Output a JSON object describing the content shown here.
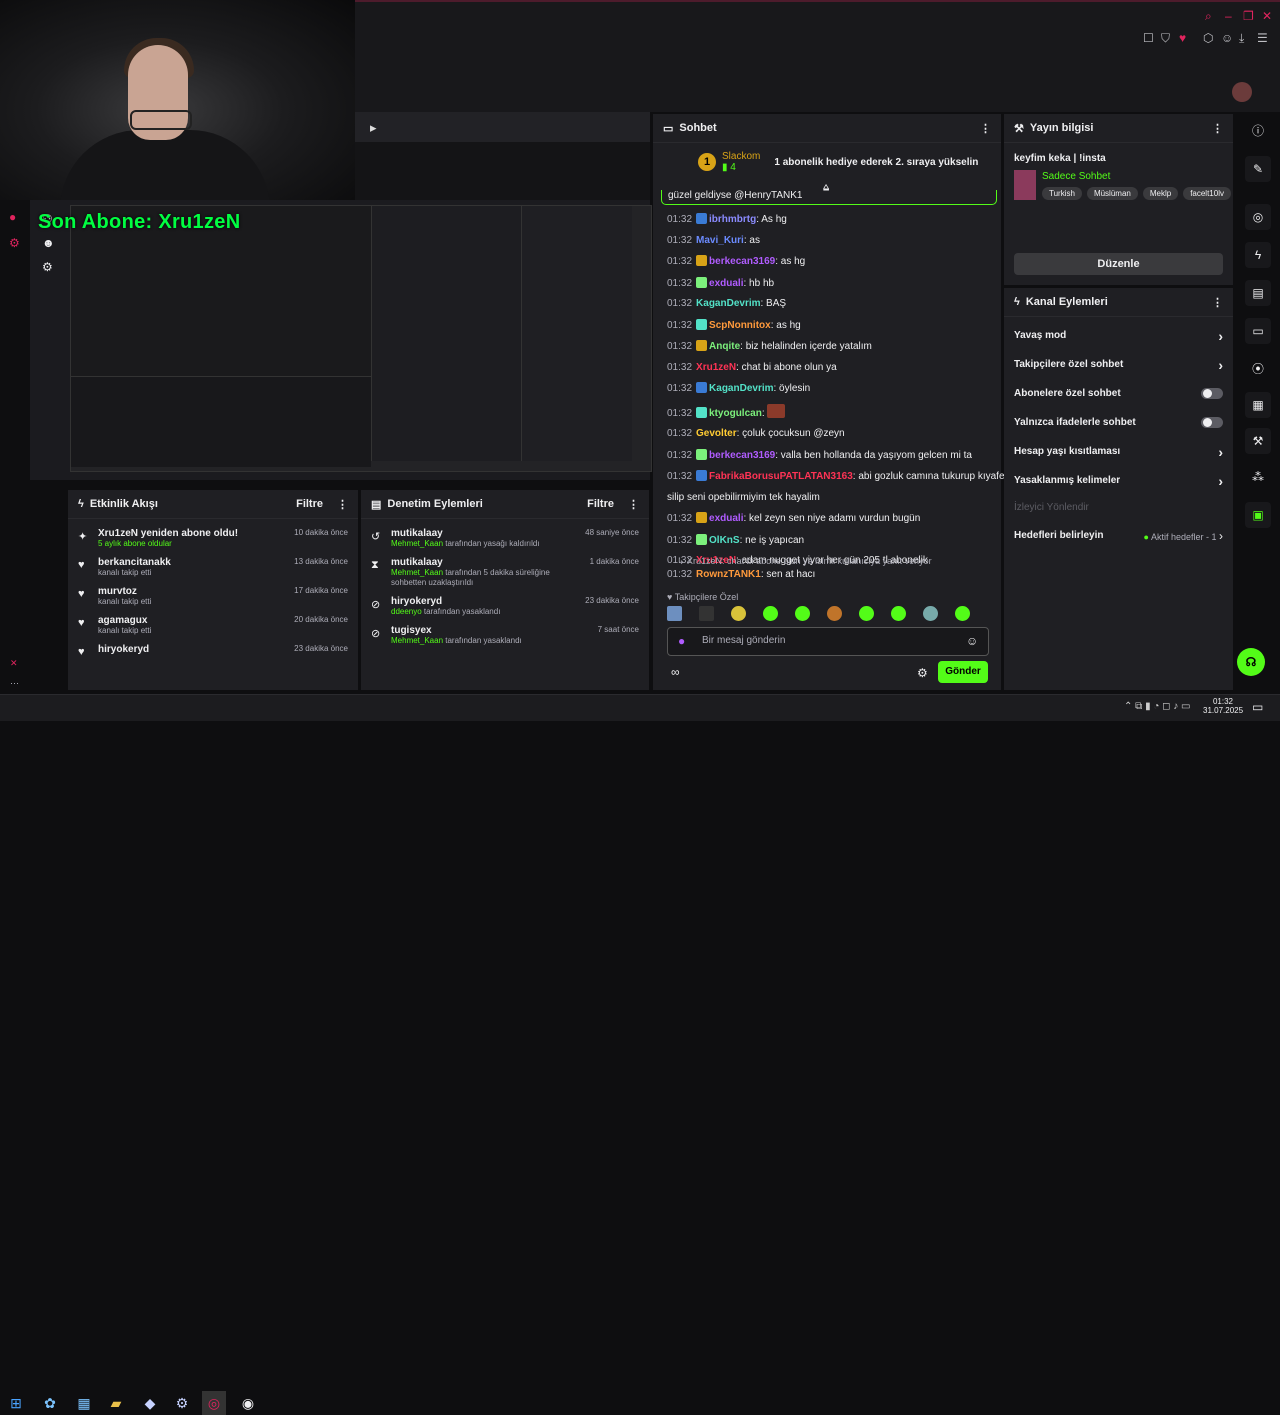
{
  "overlay": {
    "sub_alert": "Son Abone: Xru1zeN"
  },
  "chat": {
    "title": "Sohbet",
    "pinned": {
      "user": "Slackom",
      "count": "4",
      "text": "1 abonelik hediye ederek 2. sıraya yükselin"
    },
    "banner_partial": "güzel geldiyse @HenryTANK1",
    "messages": [
      {
        "time": "01:32",
        "user": "ibrhmbrtg",
        "color": "#8b8bff",
        "text": ": As hg"
      },
      {
        "time": "01:32",
        "user": "Mavi_Kuri",
        "color": "#6b8bff",
        "text": ": as"
      },
      {
        "time": "01:32",
        "user": "berkecan3169",
        "color": "#b05cff",
        "text": ": as hg"
      },
      {
        "time": "01:32",
        "user": "exduali",
        "color": "#b05cff",
        "text": ": hb hb"
      },
      {
        "time": "01:32",
        "user": "KaganDevrim",
        "color": "#53e2c8",
        "text": ": BAŞ"
      },
      {
        "time": "01:32",
        "user": "ScpNonnitox",
        "color": "#ff9a3c",
        "text": ": as hg"
      },
      {
        "time": "01:32",
        "user": "Anqite",
        "color": "#7cf07c",
        "text": ": biz helalinden içerde yatalım"
      },
      {
        "time": "01:32",
        "user": "Xru1zeN",
        "color": "#ff3355",
        "text": ": chat bi abone olun ya"
      },
      {
        "time": "01:32",
        "user": "KaganDevrim",
        "color": "#53e2c8",
        "text": ": öylesin"
      },
      {
        "time": "01:32",
        "user": "ktyogulcan",
        "color": "#7cf07c",
        "text": ":"
      },
      {
        "time": "01:32",
        "user": "Gevolter",
        "color": "#ffcc33",
        "text": ": çoluk çocuksun @zeyn"
      },
      {
        "time": "01:32",
        "user": "berkecan3169",
        "color": "#b05cff",
        "text": ": valla ben hollanda da yaşıyom gelcen mi ta"
      },
      {
        "time": "01:32",
        "user": "FabrikaBorusuPATLATAN3163",
        "color": "#ff3355",
        "text": ": abi gozluk camına tukurup kıyafetimle"
      },
      {
        "time": "",
        "user": "",
        "color": "#efeff1",
        "text": "silip seni opebilirmiyim tek hayalim"
      },
      {
        "time": "01:32",
        "user": "exduali",
        "color": "#b05cff",
        "text": ": kel zeyn sen niye adamı vurdun bugün"
      },
      {
        "time": "01:32",
        "user": "OlKnS",
        "color": "#53e2c8",
        "text": ": ne iş yapıcan"
      },
      {
        "time": "01:32",
        "user": "Xru1zeN",
        "color": "#ff3355",
        "text": ": adam nugget yiyor her gün 205 tl abonelik"
      }
    ],
    "reply_hint": "↳ Xru1zeN: chat bi abone olun ya isimli kullanıcıya yanıt veriyor",
    "last_message": {
      "time": "01:32",
      "user": "RownzTANK1",
      "color": "#ff9a3c",
      "text": ": sen at hacı"
    },
    "emote_header": "Takipçilere Özel",
    "input_placeholder": "Bir mesaj gönderin",
    "send_label": "Gönder"
  },
  "stream_info": {
    "title": "Yayın bilgisi",
    "stream_title": "keyfim keka | !insta",
    "mode": "Sadece Sohbet",
    "tags": [
      "Turkish",
      "Müslüman",
      "Meklp",
      "facelt10lv"
    ],
    "edit_label": "Düzenle"
  },
  "channel_actions": {
    "title": "Kanal Eylemleri",
    "items": [
      {
        "label": "Yavaş mod",
        "kind": "arrow"
      },
      {
        "label": "Takipçilere özel sohbet",
        "kind": "arrow"
      },
      {
        "label": "Abonelere özel sohbet",
        "kind": "toggle"
      },
      {
        "label": "Yalnızca ifadelerle sohbet",
        "kind": "toggle"
      },
      {
        "label": "Hesap yaşı kısıtlaması",
        "kind": "arrow"
      },
      {
        "label": "Yasaklanmış kelimeler",
        "kind": "arrow"
      }
    ],
    "viewer_guide": "İzleyici Yönlendir",
    "goals_label": "Hedefleri belirleyin",
    "goals_status": "Aktif hedefler - 1"
  },
  "activity": {
    "title": "Etkinlik Akışı",
    "filter": "Filtre",
    "items": [
      {
        "name": "Xru1zeN yeniden abone oldu!",
        "sub": "5 aylık abone oldular",
        "time": "10 dakika önce",
        "icon": "✦"
      },
      {
        "name": "berkancitanakk",
        "sub": "kanalı takip etti",
        "time": "13 dakika önce",
        "icon": "♥"
      },
      {
        "name": "murvtoz",
        "sub": "kanalı takip etti",
        "time": "17 dakika önce",
        "icon": "♥"
      },
      {
        "name": "agamagux",
        "sub": "kanalı takip etti",
        "time": "20 dakika önce",
        "icon": "♥"
      },
      {
        "name": "hiryokeryd",
        "sub": "",
        "time": "23 dakika önce",
        "icon": "♥"
      }
    ]
  },
  "moderation": {
    "title": "Denetim Eylemleri",
    "filter": "Filtre",
    "items": [
      {
        "name": "mutikalaay",
        "by": "Mehmet_Kaan",
        "rest": " tarafından yasağı kaldırıldı",
        "time": "48 saniye önce",
        "icon": "↺"
      },
      {
        "name": "mutikalaay",
        "by": "Mehmet_Kaan",
        "rest": " tarafından 5 dakika süreliğine sohbetten uzaklaştırıldı",
        "time": "1 dakika önce",
        "icon": "⧗"
      },
      {
        "name": "hiryokeryd",
        "by": "ddeenyo",
        "rest": " tarafından yasaklandı",
        "time": "23 dakika önce",
        "icon": "⊘"
      },
      {
        "name": "tugisyex",
        "by": "Mehmet_Kaan",
        "rest": " tarafından yasaklandı",
        "time": "7 saat önce",
        "icon": "⊘"
      }
    ]
  },
  "taskbar": {
    "time": "01:32",
    "date": "31.07.2025"
  },
  "colors": {
    "accent_green": "#53fc18",
    "text_green": "#00ff41",
    "panel": "#1f1f23",
    "bg": "#0e0e10"
  }
}
